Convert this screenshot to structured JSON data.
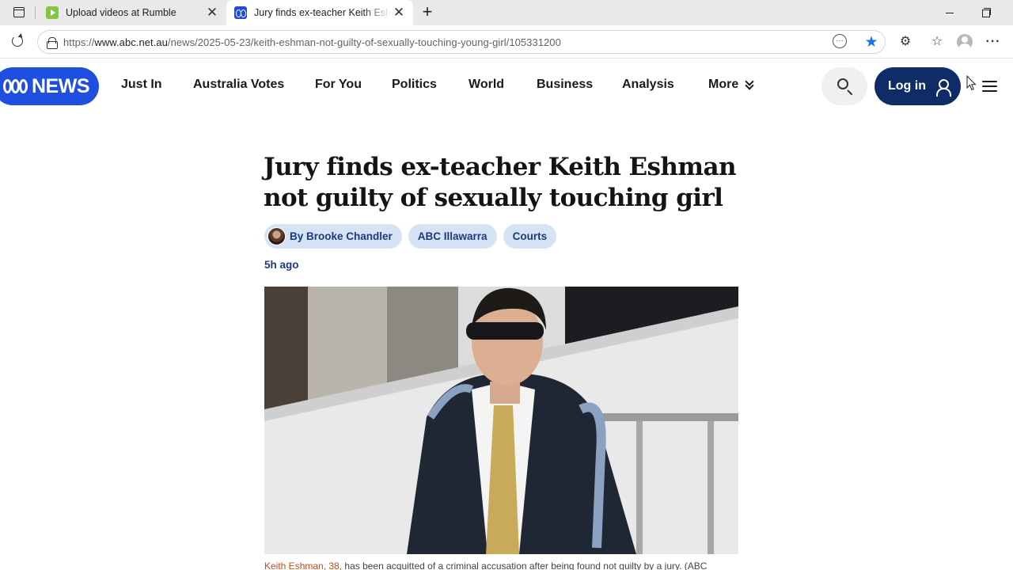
{
  "browser": {
    "tabs": [
      {
        "title": "Upload videos at Rumble",
        "favicon": "rumble-favicon",
        "active": false
      },
      {
        "title": "Jury finds ex-teacher Keith Eshman not guilty of sexually touching girl",
        "favicon": "abc-favicon",
        "active": true
      }
    ],
    "close_glyph": "✕",
    "new_tab_glyph": "+",
    "url_prefix": "https://",
    "url_host": "www.abc.net.au",
    "url_path": "/news/2025-05-23/keith-eshman-not-guilty-of-sexually-touching-young-girl/105331200",
    "star_glyph": "★",
    "extensions_glyph": "⚙",
    "favorites_glyph": "☆",
    "more_glyph": "···"
  },
  "site": {
    "logo_text": "NEWS",
    "nav": [
      {
        "label": "Just In"
      },
      {
        "label": "Australia Votes"
      },
      {
        "label": "For You"
      },
      {
        "label": "Politics"
      },
      {
        "label": "World"
      },
      {
        "label": "Business"
      },
      {
        "label": "Analysis"
      },
      {
        "label": "More"
      }
    ],
    "login_label": "Log in",
    "brand_color": "#1f4fe0",
    "login_color": "#0e2d66"
  },
  "article": {
    "headline": "Jury finds ex-teacher Keith Eshman not guilty of sexually touching girl",
    "author": "By Brooke Chandler",
    "tags": [
      "ABC Illawarra",
      "Courts"
    ],
    "timestamp": "5h ago",
    "caption_name": "Keith Eshman, 38,",
    "caption_rest": " has been acquitted of a criminal accusation after being found not guilty by a jury. (ABC"
  }
}
